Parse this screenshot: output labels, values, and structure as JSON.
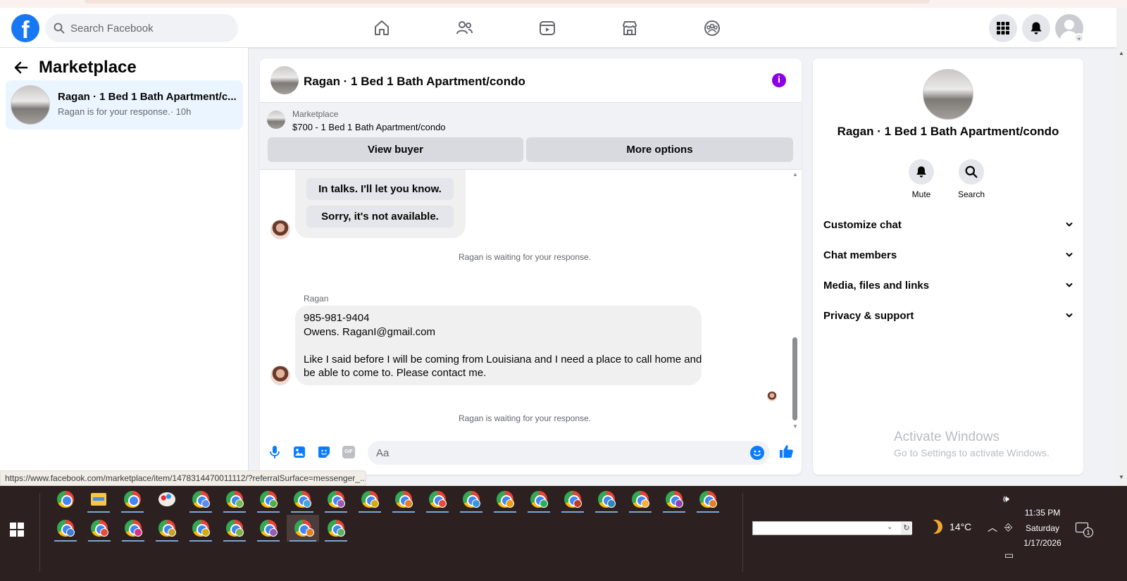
{
  "header": {
    "logo_letter": "f",
    "search_placeholder": "Search Facebook",
    "nav": [
      "home-icon",
      "friends-icon",
      "video-icon",
      "marketplace-icon",
      "groups-icon"
    ],
    "brand_color": "#1877f2"
  },
  "sidebar": {
    "title": "Marketplace",
    "conversation": {
      "title": "Ragan · 1 Bed 1 Bath Apartment/c...",
      "subtitle": "Ragan is for your response.· 10h"
    }
  },
  "chat": {
    "title": "Ragan · 1 Bed 1 Bath Apartment/condo",
    "banner": {
      "label": "Marketplace",
      "listing": "$700 - 1 Bed 1 Bath Apartment/condo",
      "view_buyer": "View buyer",
      "more_options": "More options"
    },
    "quick_replies": [
      "In talks. I'll let you know.",
      "Sorry, it's not available."
    ],
    "system_note_1": "Ragan is waiting for your response.",
    "sender_name": "Ragan",
    "message_lines": [
      "985-981-9404",
      "Owens. RaganI@gmail.com",
      "",
      "Like I said before I will be coming from Louisiana and I need a place to call home and",
      "be able to come to. Please contact me."
    ],
    "system_note_2": "Ragan is waiting for your response.",
    "composer_placeholder": "Aa",
    "gif_label": "GIF"
  },
  "details": {
    "title": "Ragan · 1 Bed 1 Bath Apartment/condo",
    "actions": [
      {
        "label": "Mute",
        "icon": "bell-icon"
      },
      {
        "label": "Search",
        "icon": "search-icon"
      }
    ],
    "sections": [
      "Customize chat",
      "Chat members",
      "Media, files and links",
      "Privacy & support"
    ],
    "watermark_line1": "Activate Windows",
    "watermark_line2": "Go to Settings to activate Windows."
  },
  "status_url": "https://www.facebook.com/marketplace/item/1478314470011112/?referralSurface=messenger_...",
  "taskbar": {
    "weather": "14°C",
    "time": "11:35 PM",
    "day": "Saturday",
    "date": "1/17/2026",
    "notification_count": "1"
  }
}
